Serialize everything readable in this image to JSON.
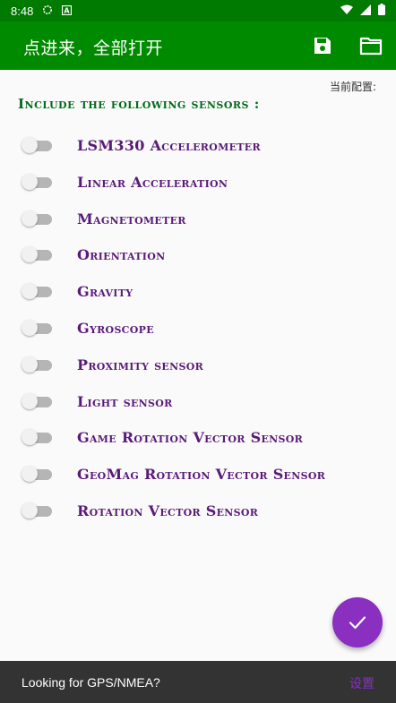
{
  "status_bar": {
    "time": "8:48",
    "icons": [
      "settings-sync-icon",
      "a-notification-icon",
      "wifi-icon",
      "signal-icon",
      "battery-icon"
    ]
  },
  "app_bar": {
    "title": "点进来，全部打开",
    "actions": [
      {
        "icon": "save-icon"
      },
      {
        "icon": "folder-icon"
      }
    ],
    "background": "#008a00"
  },
  "config": {
    "label": "当前配置:"
  },
  "section": {
    "title": "Include the following sensors :"
  },
  "sensors": [
    {
      "label": "LSM330 Accelerometer",
      "enabled": false
    },
    {
      "label": "Linear Acceleration",
      "enabled": false
    },
    {
      "label": "Magnetometer",
      "enabled": false
    },
    {
      "label": "Orientation",
      "enabled": false
    },
    {
      "label": "Gravity",
      "enabled": false
    },
    {
      "label": "Gyroscope",
      "enabled": false
    },
    {
      "label": "Proximity sensor",
      "enabled": false
    },
    {
      "label": "Light sensor",
      "enabled": false
    },
    {
      "label": "Game Rotation Vector Sensor",
      "enabled": false
    },
    {
      "label": "GeoMag Rotation Vector Sensor",
      "enabled": false
    },
    {
      "label": "Rotation Vector Sensor",
      "enabled": false
    }
  ],
  "fab": {
    "icon": "check-icon",
    "color": "#8a2fc0"
  },
  "snackbar": {
    "message": "Looking for GPS/NMEA?",
    "action": "设置"
  }
}
